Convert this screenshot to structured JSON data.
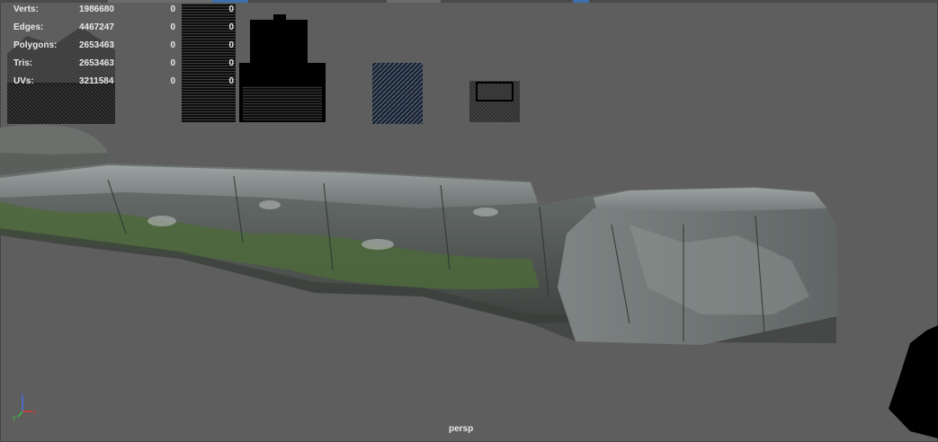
{
  "viewport": {
    "camera_label": "persp",
    "background_color": "#5e5e5e"
  },
  "heads_up_display": {
    "rows": [
      {
        "label": "Verts:",
        "scene": "1986680",
        "selected": "0",
        "uv_selected": "0"
      },
      {
        "label": "Edges:",
        "scene": "4467247",
        "selected": "0",
        "uv_selected": "0"
      },
      {
        "label": "Polygons:",
        "scene": "2653463",
        "selected": "0",
        "uv_selected": "0"
      },
      {
        "label": "Tris:",
        "scene": "2653463",
        "selected": "0",
        "uv_selected": "0"
      },
      {
        "label": "UVs:",
        "scene": "3211584",
        "selected": "0",
        "uv_selected": "0"
      }
    ]
  },
  "axis_gizmo": {
    "x_label": "x",
    "y_label": "y",
    "z_label": "z",
    "x_color": "#d93b3b",
    "y_color": "#3bbf3b",
    "z_color": "#4a6fe0"
  },
  "scene_objects": {
    "rock_color": "#7b8283",
    "moss_color": "#4e6a3a",
    "silhouette_color": "#000000"
  }
}
